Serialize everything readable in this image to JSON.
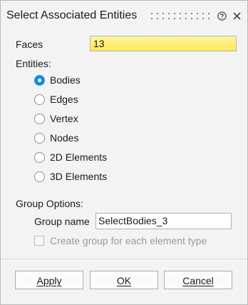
{
  "window": {
    "title": "Select Associated Entities"
  },
  "faces": {
    "label": "Faces",
    "value": "13"
  },
  "entities": {
    "label": "Entities:",
    "options": [
      {
        "label": "Bodies",
        "selected": true
      },
      {
        "label": "Edges",
        "selected": false
      },
      {
        "label": "Vertex",
        "selected": false
      },
      {
        "label": "Nodes",
        "selected": false
      },
      {
        "label": "2D Elements",
        "selected": false
      },
      {
        "label": "3D Elements",
        "selected": false
      }
    ]
  },
  "group_options": {
    "label": "Group Options:",
    "group_name_label": "Group name",
    "group_name_value": "SelectBodies_3",
    "per_type_checkbox_label": "Create group for each element type",
    "per_type_checkbox_checked": false,
    "per_type_checkbox_enabled": false
  },
  "buttons": {
    "apply": "Apply",
    "ok": "OK",
    "cancel": "Cancel"
  },
  "colors": {
    "accent": "#1a8be0",
    "field_highlight": "#ffe95b"
  },
  "icons": {
    "drag_handle": "drag-grip-icon",
    "help": "help-icon",
    "close": "close-icon"
  }
}
